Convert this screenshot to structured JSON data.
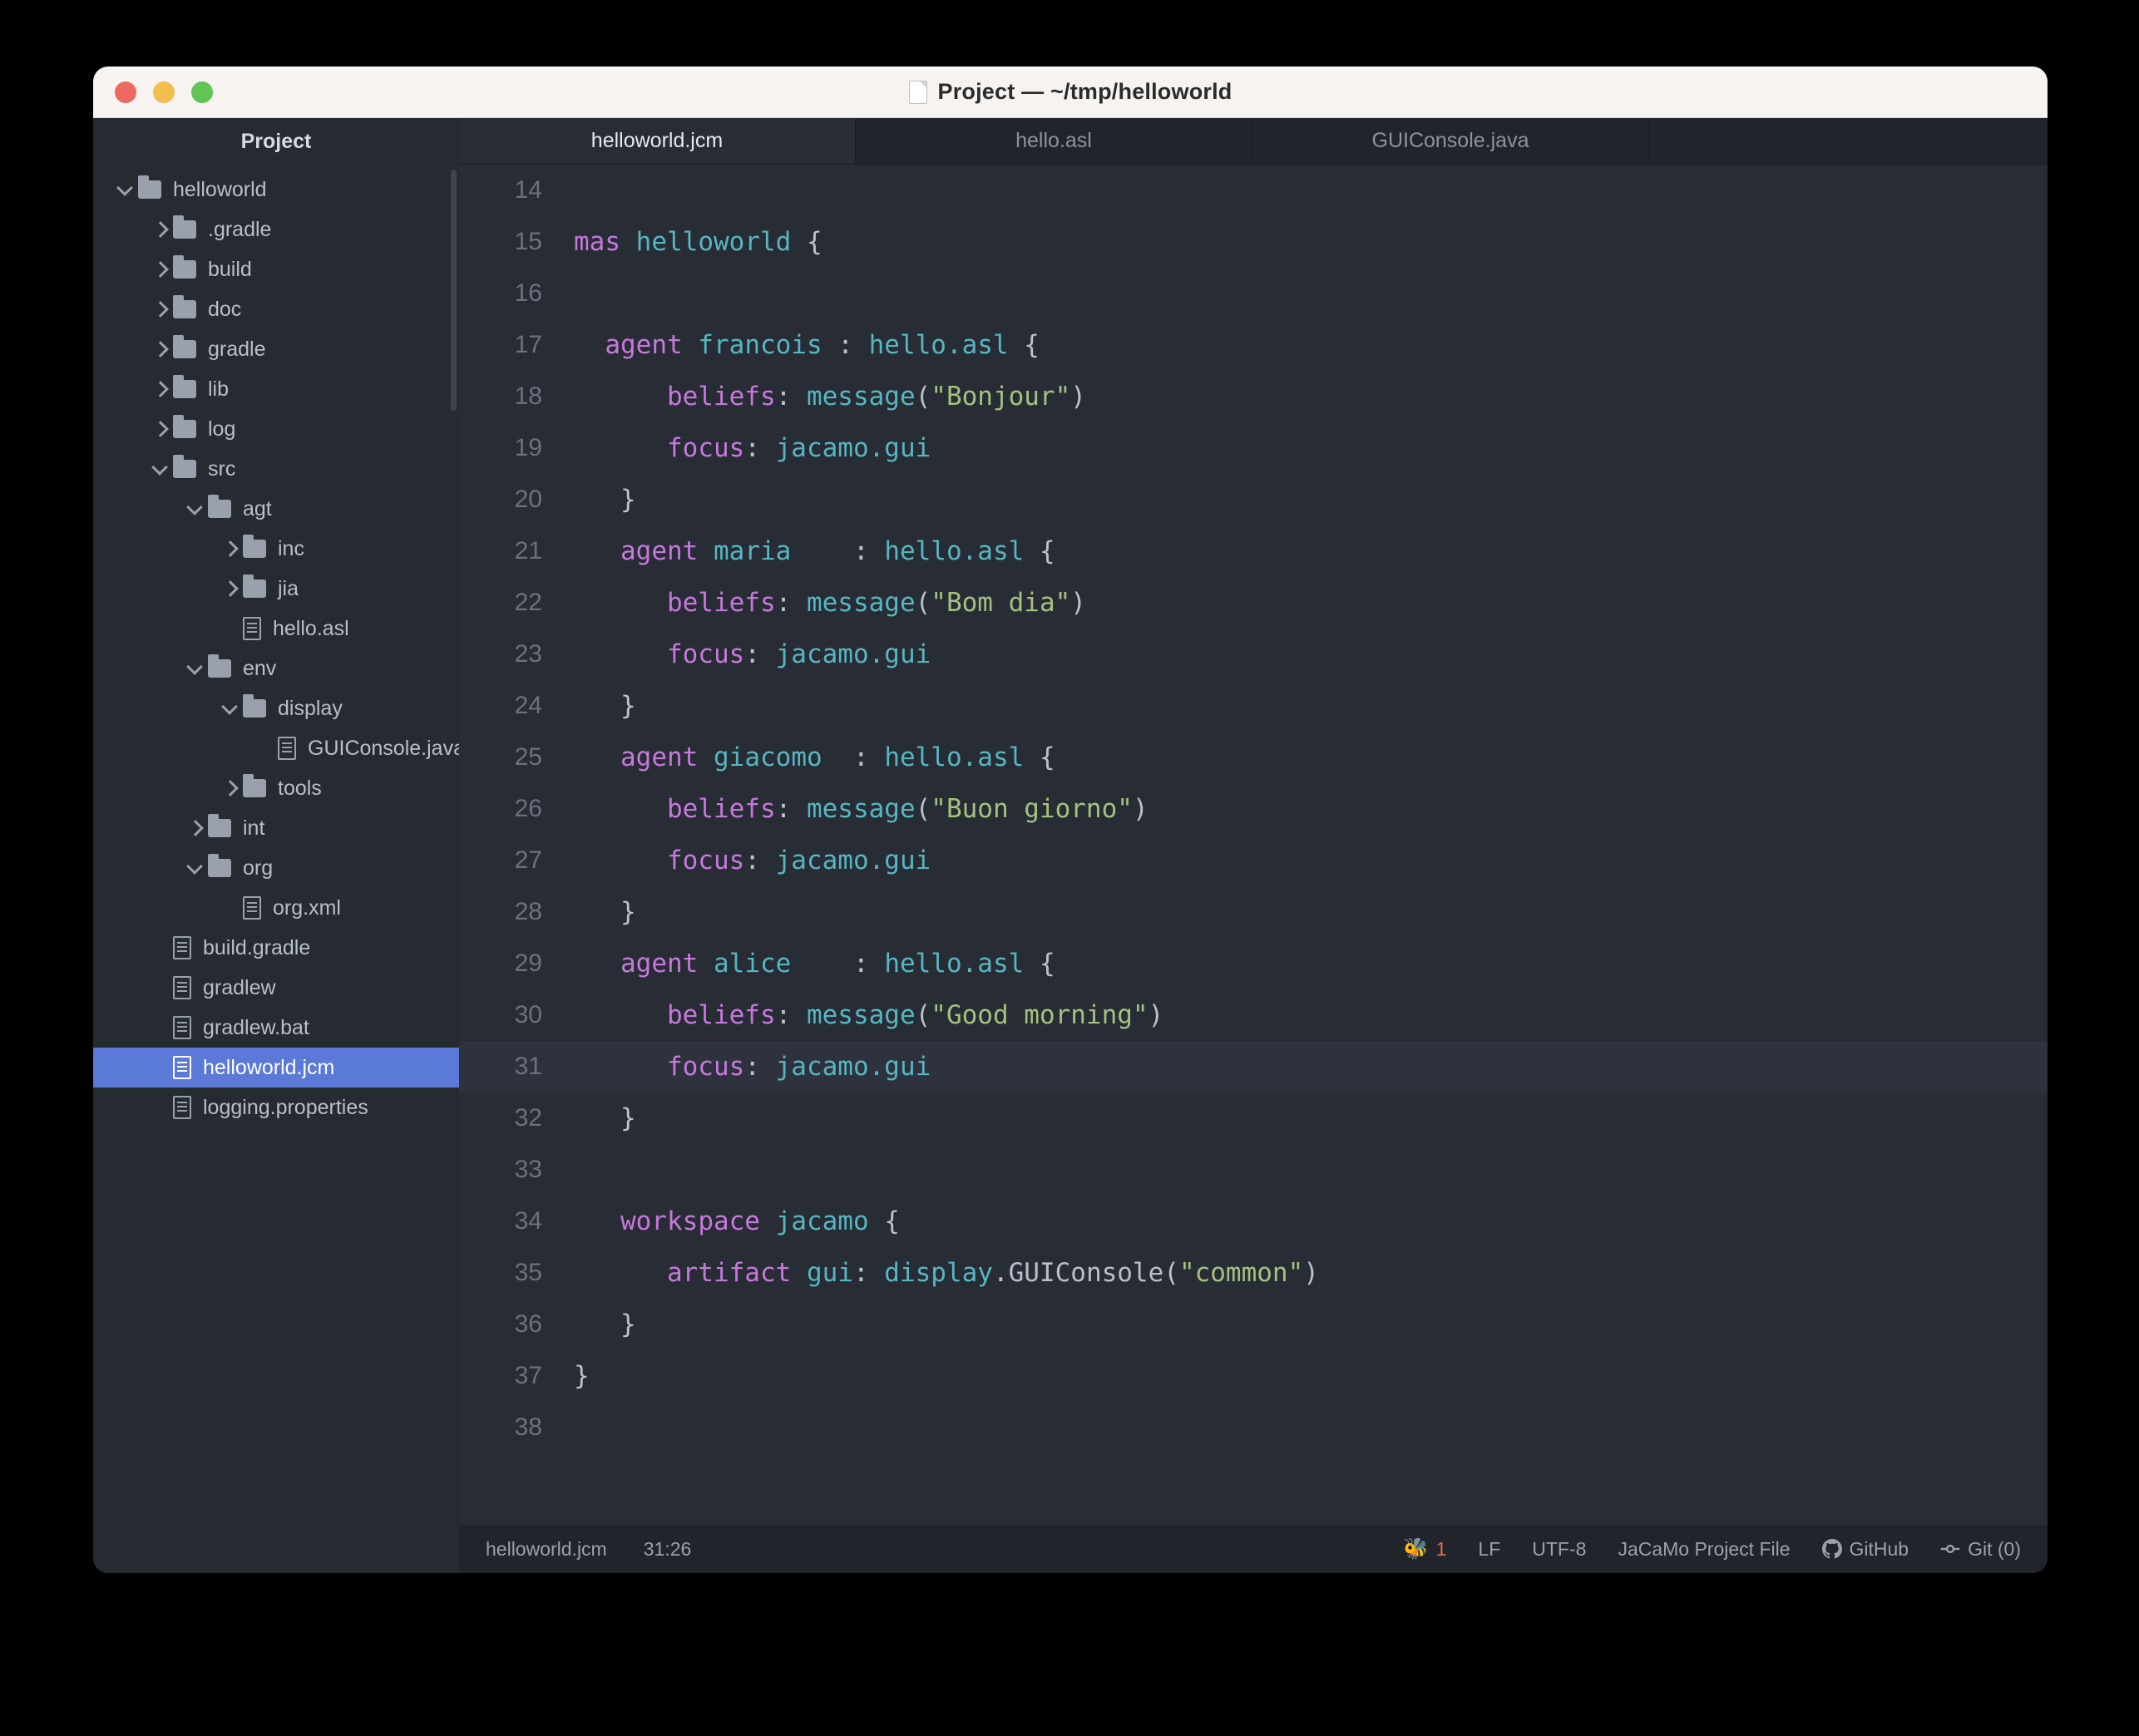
{
  "window": {
    "title": "Project — ~/tmp/helloworld",
    "title_icon": "document-icon",
    "traffic_lights": [
      "close-red",
      "minimize-yellow",
      "zoom-green"
    ]
  },
  "sidebar": {
    "header": "Project",
    "items": [
      {
        "label": "helloworld",
        "type": "folder",
        "depth": 0,
        "twisty": "down"
      },
      {
        "label": ".gradle",
        "type": "folder",
        "depth": 1,
        "twisty": "right"
      },
      {
        "label": "build",
        "type": "folder",
        "depth": 1,
        "twisty": "right"
      },
      {
        "label": "doc",
        "type": "folder",
        "depth": 1,
        "twisty": "right"
      },
      {
        "label": "gradle",
        "type": "folder",
        "depth": 1,
        "twisty": "right"
      },
      {
        "label": "lib",
        "type": "folder",
        "depth": 1,
        "twisty": "right"
      },
      {
        "label": "log",
        "type": "folder",
        "depth": 1,
        "twisty": "right"
      },
      {
        "label": "src",
        "type": "folder",
        "depth": 1,
        "twisty": "down"
      },
      {
        "label": "agt",
        "type": "folder",
        "depth": 2,
        "twisty": "down"
      },
      {
        "label": "inc",
        "type": "folder",
        "depth": 3,
        "twisty": "right"
      },
      {
        "label": "jia",
        "type": "folder",
        "depth": 3,
        "twisty": "right"
      },
      {
        "label": "hello.asl",
        "type": "file",
        "depth": 3,
        "twisty": "none"
      },
      {
        "label": "env",
        "type": "folder",
        "depth": 2,
        "twisty": "down"
      },
      {
        "label": "display",
        "type": "folder",
        "depth": 3,
        "twisty": "down"
      },
      {
        "label": "GUIConsole.java",
        "type": "file",
        "depth": 4,
        "twisty": "none"
      },
      {
        "label": "tools",
        "type": "folder",
        "depth": 3,
        "twisty": "right"
      },
      {
        "label": "int",
        "type": "folder",
        "depth": 2,
        "twisty": "right"
      },
      {
        "label": "org",
        "type": "folder",
        "depth": 2,
        "twisty": "down"
      },
      {
        "label": "org.xml",
        "type": "file",
        "depth": 3,
        "twisty": "none"
      },
      {
        "label": "build.gradle",
        "type": "file",
        "depth": 1,
        "twisty": "none"
      },
      {
        "label": "gradlew",
        "type": "file",
        "depth": 1,
        "twisty": "none"
      },
      {
        "label": "gradlew.bat",
        "type": "file",
        "depth": 1,
        "twisty": "none"
      },
      {
        "label": "helloworld.jcm",
        "type": "file",
        "depth": 1,
        "twisty": "none",
        "selected": true
      },
      {
        "label": "logging.properties",
        "type": "file",
        "depth": 1,
        "twisty": "none"
      }
    ]
  },
  "tabs": [
    {
      "label": "helloworld.jcm",
      "active": true
    },
    {
      "label": "hello.asl",
      "active": false
    },
    {
      "label": "GUIConsole.java",
      "active": false
    }
  ],
  "editor": {
    "selection_color": "#5b79d6",
    "highlighted_line": 31,
    "lines": [
      {
        "n": 14,
        "tokens": []
      },
      {
        "n": 15,
        "tokens": [
          {
            "t": "",
            "c": "pun"
          },
          {
            "t": "mas",
            "c": "kw"
          },
          {
            "t": " ",
            "c": "pun"
          },
          {
            "t": "helloworld",
            "c": "id"
          },
          {
            "t": " {",
            "c": "pun"
          }
        ]
      },
      {
        "n": 16,
        "tokens": []
      },
      {
        "n": 17,
        "tokens": [
          {
            "t": "  ",
            "c": "pun"
          },
          {
            "t": "agent",
            "c": "kw"
          },
          {
            "t": " ",
            "c": "pun"
          },
          {
            "t": "francois",
            "c": "id"
          },
          {
            "t": " : ",
            "c": "pun"
          },
          {
            "t": "hello.asl",
            "c": "id"
          },
          {
            "t": " {",
            "c": "pun"
          }
        ]
      },
      {
        "n": 18,
        "tokens": [
          {
            "t": "      ",
            "c": "pun"
          },
          {
            "t": "beliefs",
            "c": "kw"
          },
          {
            "t": ": ",
            "c": "pun"
          },
          {
            "t": "message",
            "c": "id"
          },
          {
            "t": "(",
            "c": "pun"
          },
          {
            "t": "\"Bonjour\"",
            "c": "str"
          },
          {
            "t": ")",
            "c": "pun"
          }
        ]
      },
      {
        "n": 19,
        "tokens": [
          {
            "t": "      ",
            "c": "pun"
          },
          {
            "t": "focus",
            "c": "kw"
          },
          {
            "t": ": ",
            "c": "pun"
          },
          {
            "t": "jacamo.gui",
            "c": "id"
          }
        ]
      },
      {
        "n": 20,
        "tokens": [
          {
            "t": "   }",
            "c": "pun"
          }
        ]
      },
      {
        "n": 21,
        "tokens": [
          {
            "t": "   ",
            "c": "pun"
          },
          {
            "t": "agent",
            "c": "kw"
          },
          {
            "t": " ",
            "c": "pun"
          },
          {
            "t": "maria",
            "c": "id"
          },
          {
            "t": "    : ",
            "c": "pun"
          },
          {
            "t": "hello.asl",
            "c": "id"
          },
          {
            "t": " {",
            "c": "pun"
          }
        ]
      },
      {
        "n": 22,
        "tokens": [
          {
            "t": "      ",
            "c": "pun"
          },
          {
            "t": "beliefs",
            "c": "kw"
          },
          {
            "t": ": ",
            "c": "pun"
          },
          {
            "t": "message",
            "c": "id"
          },
          {
            "t": "(",
            "c": "pun"
          },
          {
            "t": "\"Bom dia\"",
            "c": "str"
          },
          {
            "t": ")",
            "c": "pun"
          }
        ]
      },
      {
        "n": 23,
        "tokens": [
          {
            "t": "      ",
            "c": "pun"
          },
          {
            "t": "focus",
            "c": "kw"
          },
          {
            "t": ": ",
            "c": "pun"
          },
          {
            "t": "jacamo.gui",
            "c": "id"
          }
        ]
      },
      {
        "n": 24,
        "tokens": [
          {
            "t": "   }",
            "c": "pun"
          }
        ]
      },
      {
        "n": 25,
        "tokens": [
          {
            "t": "   ",
            "c": "pun"
          },
          {
            "t": "agent",
            "c": "kw"
          },
          {
            "t": " ",
            "c": "pun"
          },
          {
            "t": "giacomo",
            "c": "id"
          },
          {
            "t": "  : ",
            "c": "pun"
          },
          {
            "t": "hello.asl",
            "c": "id"
          },
          {
            "t": " {",
            "c": "pun"
          }
        ]
      },
      {
        "n": 26,
        "tokens": [
          {
            "t": "      ",
            "c": "pun"
          },
          {
            "t": "beliefs",
            "c": "kw"
          },
          {
            "t": ": ",
            "c": "pun"
          },
          {
            "t": "message",
            "c": "id"
          },
          {
            "t": "(",
            "c": "pun"
          },
          {
            "t": "\"Buon giorno\"",
            "c": "str"
          },
          {
            "t": ")",
            "c": "pun"
          }
        ]
      },
      {
        "n": 27,
        "tokens": [
          {
            "t": "      ",
            "c": "pun"
          },
          {
            "t": "focus",
            "c": "kw"
          },
          {
            "t": ": ",
            "c": "pun"
          },
          {
            "t": "jacamo.gui",
            "c": "id"
          }
        ]
      },
      {
        "n": 28,
        "tokens": [
          {
            "t": "   }",
            "c": "pun"
          }
        ]
      },
      {
        "n": 29,
        "tokens": [
          {
            "t": "   ",
            "c": "pun"
          },
          {
            "t": "agent",
            "c": "kw"
          },
          {
            "t": " ",
            "c": "pun"
          },
          {
            "t": "alice",
            "c": "id"
          },
          {
            "t": "    : ",
            "c": "pun"
          },
          {
            "t": "hello.asl",
            "c": "id"
          },
          {
            "t": " {",
            "c": "pun"
          }
        ]
      },
      {
        "n": 30,
        "tokens": [
          {
            "t": "      ",
            "c": "pun"
          },
          {
            "t": "beliefs",
            "c": "kw"
          },
          {
            "t": ": ",
            "c": "pun"
          },
          {
            "t": "message",
            "c": "id"
          },
          {
            "t": "(",
            "c": "pun"
          },
          {
            "t": "\"Good morning\"",
            "c": "str"
          },
          {
            "t": ")",
            "c": "pun"
          }
        ]
      },
      {
        "n": 31,
        "tokens": [
          {
            "t": "      ",
            "c": "pun"
          },
          {
            "t": "focus",
            "c": "kw"
          },
          {
            "t": ": ",
            "c": "pun"
          },
          {
            "t": "jacamo.gui",
            "c": "id"
          }
        ],
        "hl": true
      },
      {
        "n": 32,
        "tokens": [
          {
            "t": "   }",
            "c": "pun"
          }
        ]
      },
      {
        "n": 33,
        "tokens": []
      },
      {
        "n": 34,
        "tokens": [
          {
            "t": "   ",
            "c": "pun"
          },
          {
            "t": "workspace",
            "c": "kw"
          },
          {
            "t": " ",
            "c": "pun"
          },
          {
            "t": "jacamo",
            "c": "id"
          },
          {
            "t": " {",
            "c": "pun"
          }
        ]
      },
      {
        "n": 35,
        "tokens": [
          {
            "t": "      ",
            "c": "pun"
          },
          {
            "t": "artifact",
            "c": "kw"
          },
          {
            "t": " ",
            "c": "pun"
          },
          {
            "t": "gui",
            "c": "id"
          },
          {
            "t": ": ",
            "c": "pun"
          },
          {
            "t": "display",
            "c": "id"
          },
          {
            "t": ".",
            "c": "pun"
          },
          {
            "t": "GUIConsole",
            "c": "cls"
          },
          {
            "t": "(",
            "c": "pun"
          },
          {
            "t": "\"common\"",
            "c": "str"
          },
          {
            "t": ")",
            "c": "pun"
          }
        ]
      },
      {
        "n": 36,
        "tokens": [
          {
            "t": "   }",
            "c": "pun"
          }
        ]
      },
      {
        "n": 37,
        "tokens": [
          {
            "t": "}",
            "c": "pun"
          }
        ]
      },
      {
        "n": 38,
        "tokens": []
      }
    ]
  },
  "statusbar": {
    "filename": "helloworld.jcm",
    "cursor": "31:26",
    "bug_count": "1",
    "line_ending": "LF",
    "encoding": "UTF-8",
    "file_type": "JaCaMo Project File",
    "github": "GitHub",
    "git": "Git (0)"
  },
  "colors": {
    "accent_selection": "#5b79d6",
    "editor_bg": "#282c34",
    "keyword": "#c678dd",
    "identifier": "#56b6c2",
    "string": "#a7c080",
    "error": "#e8614d"
  }
}
